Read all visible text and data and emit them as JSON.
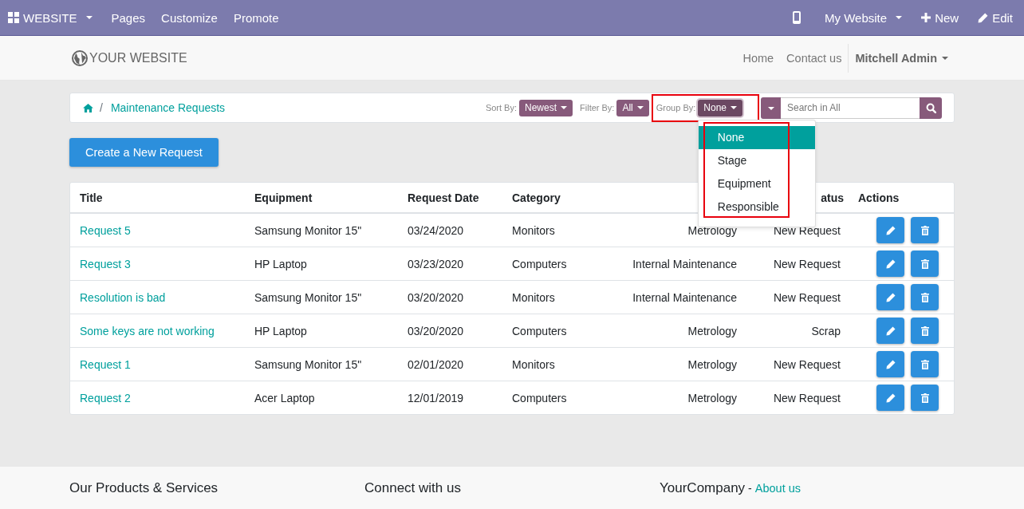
{
  "topbar": {
    "app_menu": "WEBSITE",
    "items": [
      "Pages",
      "Customize",
      "Promote"
    ],
    "website": "My Website",
    "new": "New",
    "edit": "Edit"
  },
  "header": {
    "logo": "YOUR WEBSITE",
    "nav": [
      {
        "label": "Home"
      },
      {
        "label": "Contact us"
      }
    ],
    "user": "Mitchell Admin"
  },
  "breadcrumb": {
    "separator": "/",
    "current": "Maintenance Requests"
  },
  "controls": {
    "sort_label": "Sort By:",
    "sort_value": "Newest",
    "filter_label": "Filter By:",
    "filter_value": "All",
    "group_label": "Group By:",
    "group_value": "None",
    "search_placeholder": "Search in All"
  },
  "group_menu": {
    "expanded": true,
    "options": [
      {
        "label": "None",
        "selected": true
      },
      {
        "label": "Stage",
        "selected": false
      },
      {
        "label": "Equipment",
        "selected": false
      },
      {
        "label": "Responsible",
        "selected": false
      }
    ]
  },
  "create_button": "Create a New Request",
  "table": {
    "columns": [
      "Title",
      "Equipment",
      "Request Date",
      "Category",
      "",
      "atus",
      "Actions"
    ],
    "rows": [
      {
        "title": "Request 5",
        "equipment": "Samsung Monitor 15\"",
        "date": "03/24/2020",
        "category": "Monitors",
        "column_5": "Metrology",
        "status": "New Request"
      },
      {
        "title": "Request 3",
        "equipment": "HP Laptop",
        "date": "03/23/2020",
        "category": "Computers",
        "column_5": "Internal Maintenance",
        "status": "New Request"
      },
      {
        "title": "Resolution is bad",
        "equipment": "Samsung Monitor 15\"",
        "date": "03/20/2020",
        "category": "Monitors",
        "column_5": "Internal Maintenance",
        "status": "New Request"
      },
      {
        "title": "Some keys are not working",
        "equipment": "HP Laptop",
        "date": "03/20/2020",
        "category": "Computers",
        "column_5": "Metrology",
        "status": "Scrap"
      },
      {
        "title": "Request 1",
        "equipment": "Samsung Monitor 15\"",
        "date": "02/01/2020",
        "category": "Monitors",
        "column_5": "Metrology",
        "status": "New Request"
      },
      {
        "title": "Request 2",
        "equipment": "Acer Laptop",
        "date": "12/01/2019",
        "category": "Computers",
        "column_5": "Metrology",
        "status": "New Request"
      }
    ]
  },
  "footer": {
    "col1": "Our Products & Services",
    "col2": "Connect with us",
    "col3": "YourCompany",
    "col3_sep": "-",
    "col3_link": "About us"
  }
}
